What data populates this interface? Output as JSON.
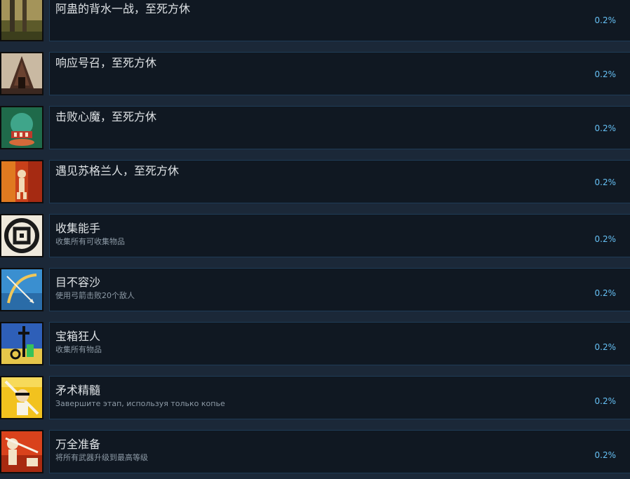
{
  "achievements": [
    {
      "name": "阿蛊的背水一战，至死方休",
      "description": "",
      "percent": "0.2%",
      "icon": "two-trees-icon"
    },
    {
      "name": "响应号召，至死方休",
      "description": "",
      "percent": "0.2%",
      "icon": "temple-tower-icon"
    },
    {
      "name": "击败心魔，至死方休",
      "description": "",
      "percent": "0.2%",
      "icon": "demon-mask-icon"
    },
    {
      "name": "遇见苏格兰人，至死方休",
      "description": "",
      "percent": "0.2%",
      "icon": "samurai-fire-icon"
    },
    {
      "name": "收集能手",
      "description": "收集所有可收集物品",
      "percent": "0.2%",
      "icon": "collectible-emblem-icon"
    },
    {
      "name": "目不容沙",
      "description": "使用弓箭击败20个敌人",
      "percent": "0.2%",
      "icon": "bow-arrow-icon"
    },
    {
      "name": "宝箱狂人",
      "description": "收集所有物品",
      "percent": "0.2%",
      "icon": "treasure-items-icon"
    },
    {
      "name": "矛术精髓",
      "description": "Завершите этап, используя только копье",
      "percent": "0.2%",
      "icon": "spear-samurai-icon"
    },
    {
      "name": "万全准备",
      "description": "将所有武器升级到最高等级",
      "percent": "0.2%",
      "icon": "samurai-sunset-icon"
    }
  ]
}
